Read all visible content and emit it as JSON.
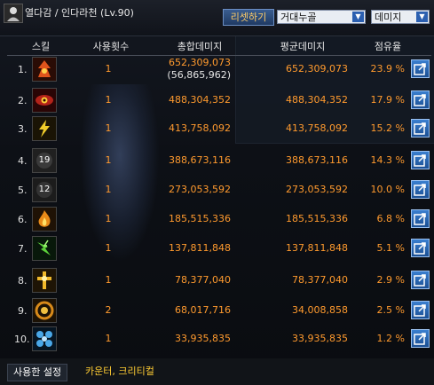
{
  "window": {
    "title": "열다감 / 인다라천 (Lv.90)",
    "reset_label": "리셋하기",
    "select_mode": "거대누골",
    "select_metric": "데미지"
  },
  "columns": {
    "skill": "스킬",
    "count": "사용횟수",
    "total": "총합데미지",
    "avg": "평균데미지",
    "share": "점유율"
  },
  "rows": [
    {
      "rank": "1.",
      "count": "1",
      "total": "652,309,073",
      "total_sub": "(56,865,962)",
      "avg": "652,309,073",
      "pct": "23.9 %",
      "icon": "fire-demon-icon",
      "color": "#d0461a"
    },
    {
      "rank": "2.",
      "count": "1",
      "total": "488,304,352",
      "total_sub": "",
      "avg": "488,304,352",
      "pct": "17.9 %",
      "icon": "red-eye-icon",
      "color": "#b3231a"
    },
    {
      "rank": "3.",
      "count": "1",
      "total": "413,758,092",
      "total_sub": "",
      "avg": "413,758,092",
      "pct": "15.2 %",
      "icon": "lightning-icon",
      "color": "#e6c020"
    },
    {
      "rank": "4.",
      "count": "1",
      "total": "388,673,116",
      "total_sub": "",
      "avg": "388,673,116",
      "pct": "14.3 %",
      "icon": "cooldown-19-icon",
      "color": "#555555"
    },
    {
      "rank": "5.",
      "count": "1",
      "total": "273,053,592",
      "total_sub": "",
      "avg": "273,053,592",
      "pct": "10.0 %",
      "icon": "cooldown-12-icon",
      "color": "#444444"
    },
    {
      "rank": "6.",
      "count": "1",
      "total": "185,515,336",
      "total_sub": "",
      "avg": "185,515,336",
      "pct": "6.8 %",
      "icon": "flame-icon",
      "color": "#e08a18"
    },
    {
      "rank": "7.",
      "count": "1",
      "total": "137,811,848",
      "total_sub": "",
      "avg": "137,811,848",
      "pct": "5.1 %",
      "icon": "green-lightning-icon",
      "color": "#4caf2a"
    },
    {
      "rank": "8.",
      "count": "1",
      "total": "78,377,040",
      "total_sub": "",
      "avg": "78,377,040",
      "pct": "2.9 %",
      "icon": "holy-cross-icon",
      "color": "#e6a81e"
    },
    {
      "rank": "9.",
      "count": "2",
      "total": "68,017,716",
      "total_sub": "",
      "avg": "34,008,858",
      "pct": "2.5 %",
      "icon": "orange-sigil-icon",
      "color": "#c87a14"
    },
    {
      "rank": "10.",
      "count": "1",
      "total": "33,935,835",
      "total_sub": "",
      "avg": "33,935,835",
      "pct": "1.2 %",
      "icon": "blue-orb-icon",
      "color": "#2a8ad0"
    }
  ],
  "cooldowns": {
    "row4": "19",
    "row5": "12"
  },
  "tabs": {
    "settings": "사용한 설정",
    "counter": "카운터, 크리티컬"
  }
}
